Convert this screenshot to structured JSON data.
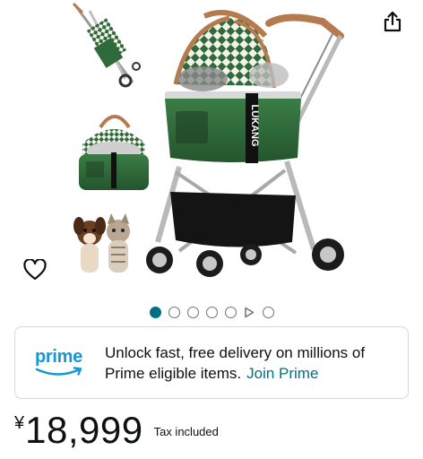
{
  "product": {
    "brand_label": "LUKANG"
  },
  "gallery": {
    "dots_total": 6,
    "active_dot": 1,
    "has_video_dot": true
  },
  "prime": {
    "logo_text": "prime",
    "message": "Unlock fast, free delivery on millions of Prime eligible items.",
    "join_label": "Join Prime"
  },
  "price": {
    "symbol": "¥",
    "amount": "18,999",
    "tax_note": "Tax included"
  },
  "colors": {
    "prime_blue": "#1399d6",
    "link_teal": "#007185",
    "carrier_green": "#2f6b3a",
    "check_green": "#2e6a3c",
    "tan_handle": "#b57a4d"
  },
  "icons": {
    "share": "share-icon",
    "wishlist": "heart-icon",
    "play": "play-icon"
  }
}
